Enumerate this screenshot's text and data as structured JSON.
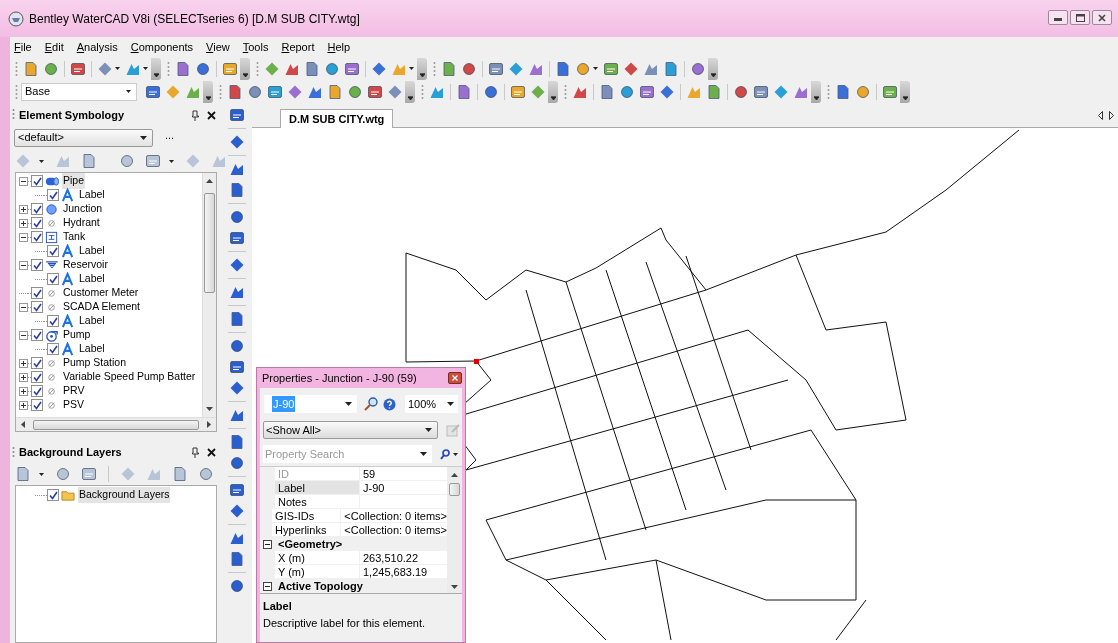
{
  "window": {
    "title": "Bentley WaterCAD V8i (SELECTseries 6) [D.M SUB CITY.wtg]"
  },
  "menu": [
    "File",
    "Edit",
    "Analysis",
    "Components",
    "View",
    "Tools",
    "Report",
    "Help"
  ],
  "scenario_box": {
    "value": "Base"
  },
  "element_symbology": {
    "title": "Element Symbology",
    "dropdown": "<default>",
    "more": "...",
    "tree": [
      {
        "label": "Pipe",
        "kind": "pipe",
        "checked": true,
        "expanded": true,
        "selected": true,
        "children": [
          {
            "label": "Label",
            "kind": "label",
            "checked": true,
            "selected": false
          }
        ]
      },
      {
        "label": "Junction",
        "kind": "junction",
        "checked": true,
        "expanded": false,
        "selected": false
      },
      {
        "label": "Hydrant",
        "kind": "none",
        "checked": true,
        "expanded": false,
        "selected": false
      },
      {
        "label": "Tank",
        "kind": "tank",
        "checked": true,
        "expanded": true,
        "selected": false,
        "children": [
          {
            "label": "Label",
            "kind": "label",
            "checked": true,
            "selected": false
          }
        ]
      },
      {
        "label": "Reservoir",
        "kind": "reservoir",
        "checked": true,
        "expanded": true,
        "selected": false,
        "children": [
          {
            "label": "Label",
            "kind": "label",
            "checked": true,
            "selected": false
          }
        ]
      },
      {
        "label": "Customer Meter",
        "kind": "none",
        "checked": true,
        "selected": false
      },
      {
        "label": "SCADA Element",
        "kind": "none",
        "checked": true,
        "expanded": true,
        "selected": false,
        "children": [
          {
            "label": "Label",
            "kind": "label",
            "checked": true,
            "selected": false
          }
        ]
      },
      {
        "label": "Pump",
        "kind": "pump",
        "checked": true,
        "expanded": true,
        "selected": false,
        "children": [
          {
            "label": "Label",
            "kind": "label",
            "checked": true,
            "selected": false
          }
        ]
      },
      {
        "label": "Pump Station",
        "kind": "none",
        "checked": true,
        "expanded": false,
        "selected": false
      },
      {
        "label": "Variable Speed Pump Batter",
        "kind": "none",
        "checked": true,
        "expanded": false,
        "selected": false
      },
      {
        "label": "PRV",
        "kind": "none",
        "checked": true,
        "expanded": false,
        "selected": false
      },
      {
        "label": "PSV",
        "kind": "none",
        "checked": true,
        "expanded": false,
        "selected": false
      }
    ]
  },
  "background_layers": {
    "title": "Background Layers",
    "tree": [
      {
        "label": "Background Layers",
        "kind": "folder",
        "checked": true,
        "selected": true
      }
    ]
  },
  "tabs": [
    {
      "label": "D.M SUB CITY.wtg",
      "selected": true
    }
  ],
  "properties": {
    "title": "Properties - Junction - J-90 (59)",
    "element": "J-90",
    "zoom": "100%",
    "filter": "<Show All>",
    "search": {
      "placeholder": "Property Search"
    },
    "rows": [
      {
        "kind": "property",
        "name": "ID",
        "value": "59",
        "disabled": true,
        "selected": false
      },
      {
        "kind": "property",
        "name": "Label",
        "value": "J-90",
        "disabled": false,
        "selected": true
      },
      {
        "kind": "property",
        "name": "Notes",
        "disabled": false,
        "selected": false
      },
      {
        "kind": "property",
        "name": "GIS-IDs",
        "value": "<Collection: 0 items>",
        "disabled": false,
        "selected": false
      },
      {
        "kind": "property",
        "name": "Hyperlinks",
        "value": "<Collection: 0 items>",
        "disabled": false,
        "selected": false
      },
      {
        "kind": "category",
        "name": "<Geometry>",
        "expanded": true
      },
      {
        "kind": "property",
        "name": "X (m)",
        "value": "263,510.22",
        "disabled": false,
        "selected": false
      },
      {
        "kind": "property",
        "name": "Y (m)",
        "value": "1,245,683.19",
        "disabled": false,
        "selected": false
      },
      {
        "kind": "category",
        "name": "Active Topology",
        "expanded": true
      }
    ],
    "help": {
      "title": "Label",
      "text": "Descriptive label for this element."
    }
  }
}
